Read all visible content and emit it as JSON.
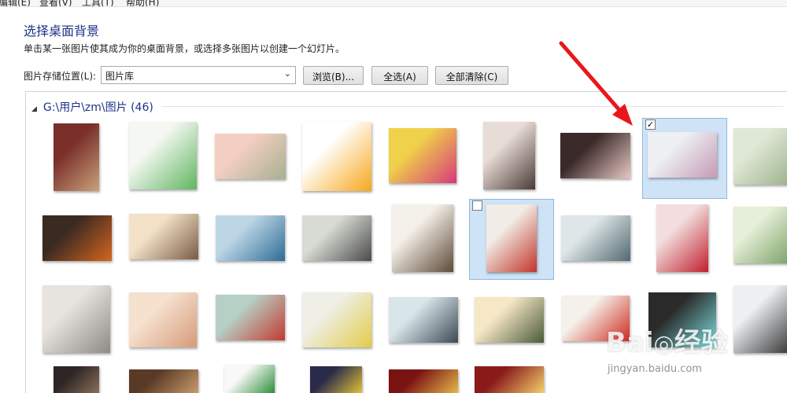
{
  "menubar": {
    "items": [
      "编辑(E)",
      "查看(V)",
      "工具(T)",
      "帮助(H)"
    ]
  },
  "page": {
    "title": "选择桌面背景",
    "subtitle": "单击某一张图片使其成为你的桌面背景，或选择多张图片以创建一个幻灯片。"
  },
  "location": {
    "label": "图片存储位置(L):",
    "selected": "图片库"
  },
  "buttons": {
    "browse": "浏览(B)...",
    "select_all": "全选(A)",
    "clear_all": "全部清除(C)"
  },
  "group": {
    "header": "G:\\用户\\zm\\图片 (46)"
  },
  "thumbnails": [
    {
      "name": "thumb-cafe-wall",
      "colors": [
        "#7a2f2a",
        "#c9a27a"
      ],
      "selected": false,
      "checked": false
    },
    {
      "name": "thumb-share-card",
      "colors": [
        "#f4f7f2",
        "#5fb65f"
      ],
      "selected": false,
      "checked": false
    },
    {
      "name": "thumb-bokeh-pink",
      "colors": [
        "#f3cfc3",
        "#a8b08e"
      ],
      "selected": false,
      "checked": false
    },
    {
      "name": "thumb-smiley",
      "colors": [
        "#ffffff",
        "#f7a71b"
      ],
      "selected": false,
      "checked": false
    },
    {
      "name": "thumb-anime-girl",
      "colors": [
        "#f0d14a",
        "#d63a7a"
      ],
      "selected": false,
      "checked": false
    },
    {
      "name": "thumb-girl-portrait",
      "colors": [
        "#e8dcd6",
        "#4a3a36"
      ],
      "selected": false,
      "checked": false
    },
    {
      "name": "thumb-group-girls",
      "colors": [
        "#3a2a2a",
        "#e7c9c3"
      ],
      "selected": false,
      "checked": false
    },
    {
      "name": "thumb-girls-room",
      "colors": [
        "#eef0f4",
        "#c49ab4"
      ],
      "selected": true,
      "checked": true
    },
    {
      "name": "thumb-green-garden",
      "colors": [
        "#dfe8d6",
        "#9fb38e"
      ],
      "selected": false,
      "checked": false
    },
    {
      "name": "thumb-food-bowl",
      "colors": [
        "#3a2a22",
        "#d8651e"
      ],
      "selected": false,
      "checked": false
    },
    {
      "name": "thumb-sunlight-girl",
      "colors": [
        "#f3e2c8",
        "#7b5a44"
      ],
      "selected": false,
      "checked": false
    },
    {
      "name": "thumb-sea-girl",
      "colors": [
        "#bcd6e6",
        "#2e6b93"
      ],
      "selected": false,
      "checked": false
    },
    {
      "name": "thumb-girl-flowers",
      "colors": [
        "#d8dcd4",
        "#4a4a4a"
      ],
      "selected": false,
      "checked": false
    },
    {
      "name": "thumb-guitar-poster",
      "colors": [
        "#f4f1ea",
        "#5e4a36"
      ],
      "selected": false,
      "checked": false
    },
    {
      "name": "thumb-red-leaves",
      "colors": [
        "#f1ede6",
        "#c2342a"
      ],
      "selected": true,
      "checked": false
    },
    {
      "name": "thumb-boy-sitting",
      "colors": [
        "#dfe6e8",
        "#51696f"
      ],
      "selected": false,
      "checked": false
    },
    {
      "name": "thumb-girl-red-scarf",
      "colors": [
        "#f2dede",
        "#c01f2d"
      ],
      "selected": false,
      "checked": false
    },
    {
      "name": "thumb-green-blur",
      "colors": [
        "#e6efd9",
        "#7da46a"
      ],
      "selected": false,
      "checked": false
    },
    {
      "name": "thumb-clock-lamp",
      "colors": [
        "#e8e4df",
        "#8d8a85"
      ],
      "selected": false,
      "checked": false
    },
    {
      "name": "thumb-baby-face",
      "colors": [
        "#f6e1cf",
        "#d69a79"
      ],
      "selected": false,
      "checked": false
    },
    {
      "name": "thumb-alarm-clock",
      "colors": [
        "#b7d0c5",
        "#c2392f"
      ],
      "selected": false,
      "checked": false
    },
    {
      "name": "thumb-chicks",
      "colors": [
        "#efefe8",
        "#e3cc48"
      ],
      "selected": false,
      "checked": false
    },
    {
      "name": "thumb-beach-girl",
      "colors": [
        "#d8e6ec",
        "#3a4a50"
      ],
      "selected": false,
      "checked": false
    },
    {
      "name": "thumb-sunset-girls",
      "colors": [
        "#f6e7c6",
        "#4a5a3a"
      ],
      "selected": false,
      "checked": false
    },
    {
      "name": "thumb-mushroom",
      "colors": [
        "#f4f0ea",
        "#cf2b1f"
      ],
      "selected": false,
      "checked": false
    },
    {
      "name": "thumb-jellyfish-toy",
      "colors": [
        "#2a2a2a",
        "#7ee0e0"
      ],
      "selected": false,
      "checked": false
    },
    {
      "name": "thumb-white-dress-girl",
      "colors": [
        "#eef0f2",
        "#3a3a3a"
      ],
      "selected": false,
      "checked": false
    },
    {
      "name": "thumb-dark-portrait",
      "colors": [
        "#2e2624",
        "#8a6e5c"
      ],
      "selected": false,
      "checked": false
    },
    {
      "name": "thumb-brown-room",
      "colors": [
        "#5a3a26",
        "#c79a6a"
      ],
      "selected": false,
      "checked": false
    },
    {
      "name": "thumb-cartoon-sketch",
      "colors": [
        "#f8f8f8",
        "#2c8f3a"
      ],
      "selected": false,
      "checked": false
    },
    {
      "name": "thumb-colorful-toys",
      "colors": [
        "#2a2a4a",
        "#e0c23a"
      ],
      "selected": false,
      "checked": false
    },
    {
      "name": "thumb-red-sign",
      "colors": [
        "#7a1212",
        "#e4b64a"
      ],
      "selected": false,
      "checked": false
    },
    {
      "name": "thumb-chinese-shop",
      "colors": [
        "#8a1a1a",
        "#f2d06a"
      ],
      "selected": false,
      "checked": false
    }
  ],
  "watermark": {
    "logo": "Baidu 经验",
    "url": "jingyan.baidu.com"
  },
  "annotation": {
    "arrow_color": "#e8171c"
  }
}
